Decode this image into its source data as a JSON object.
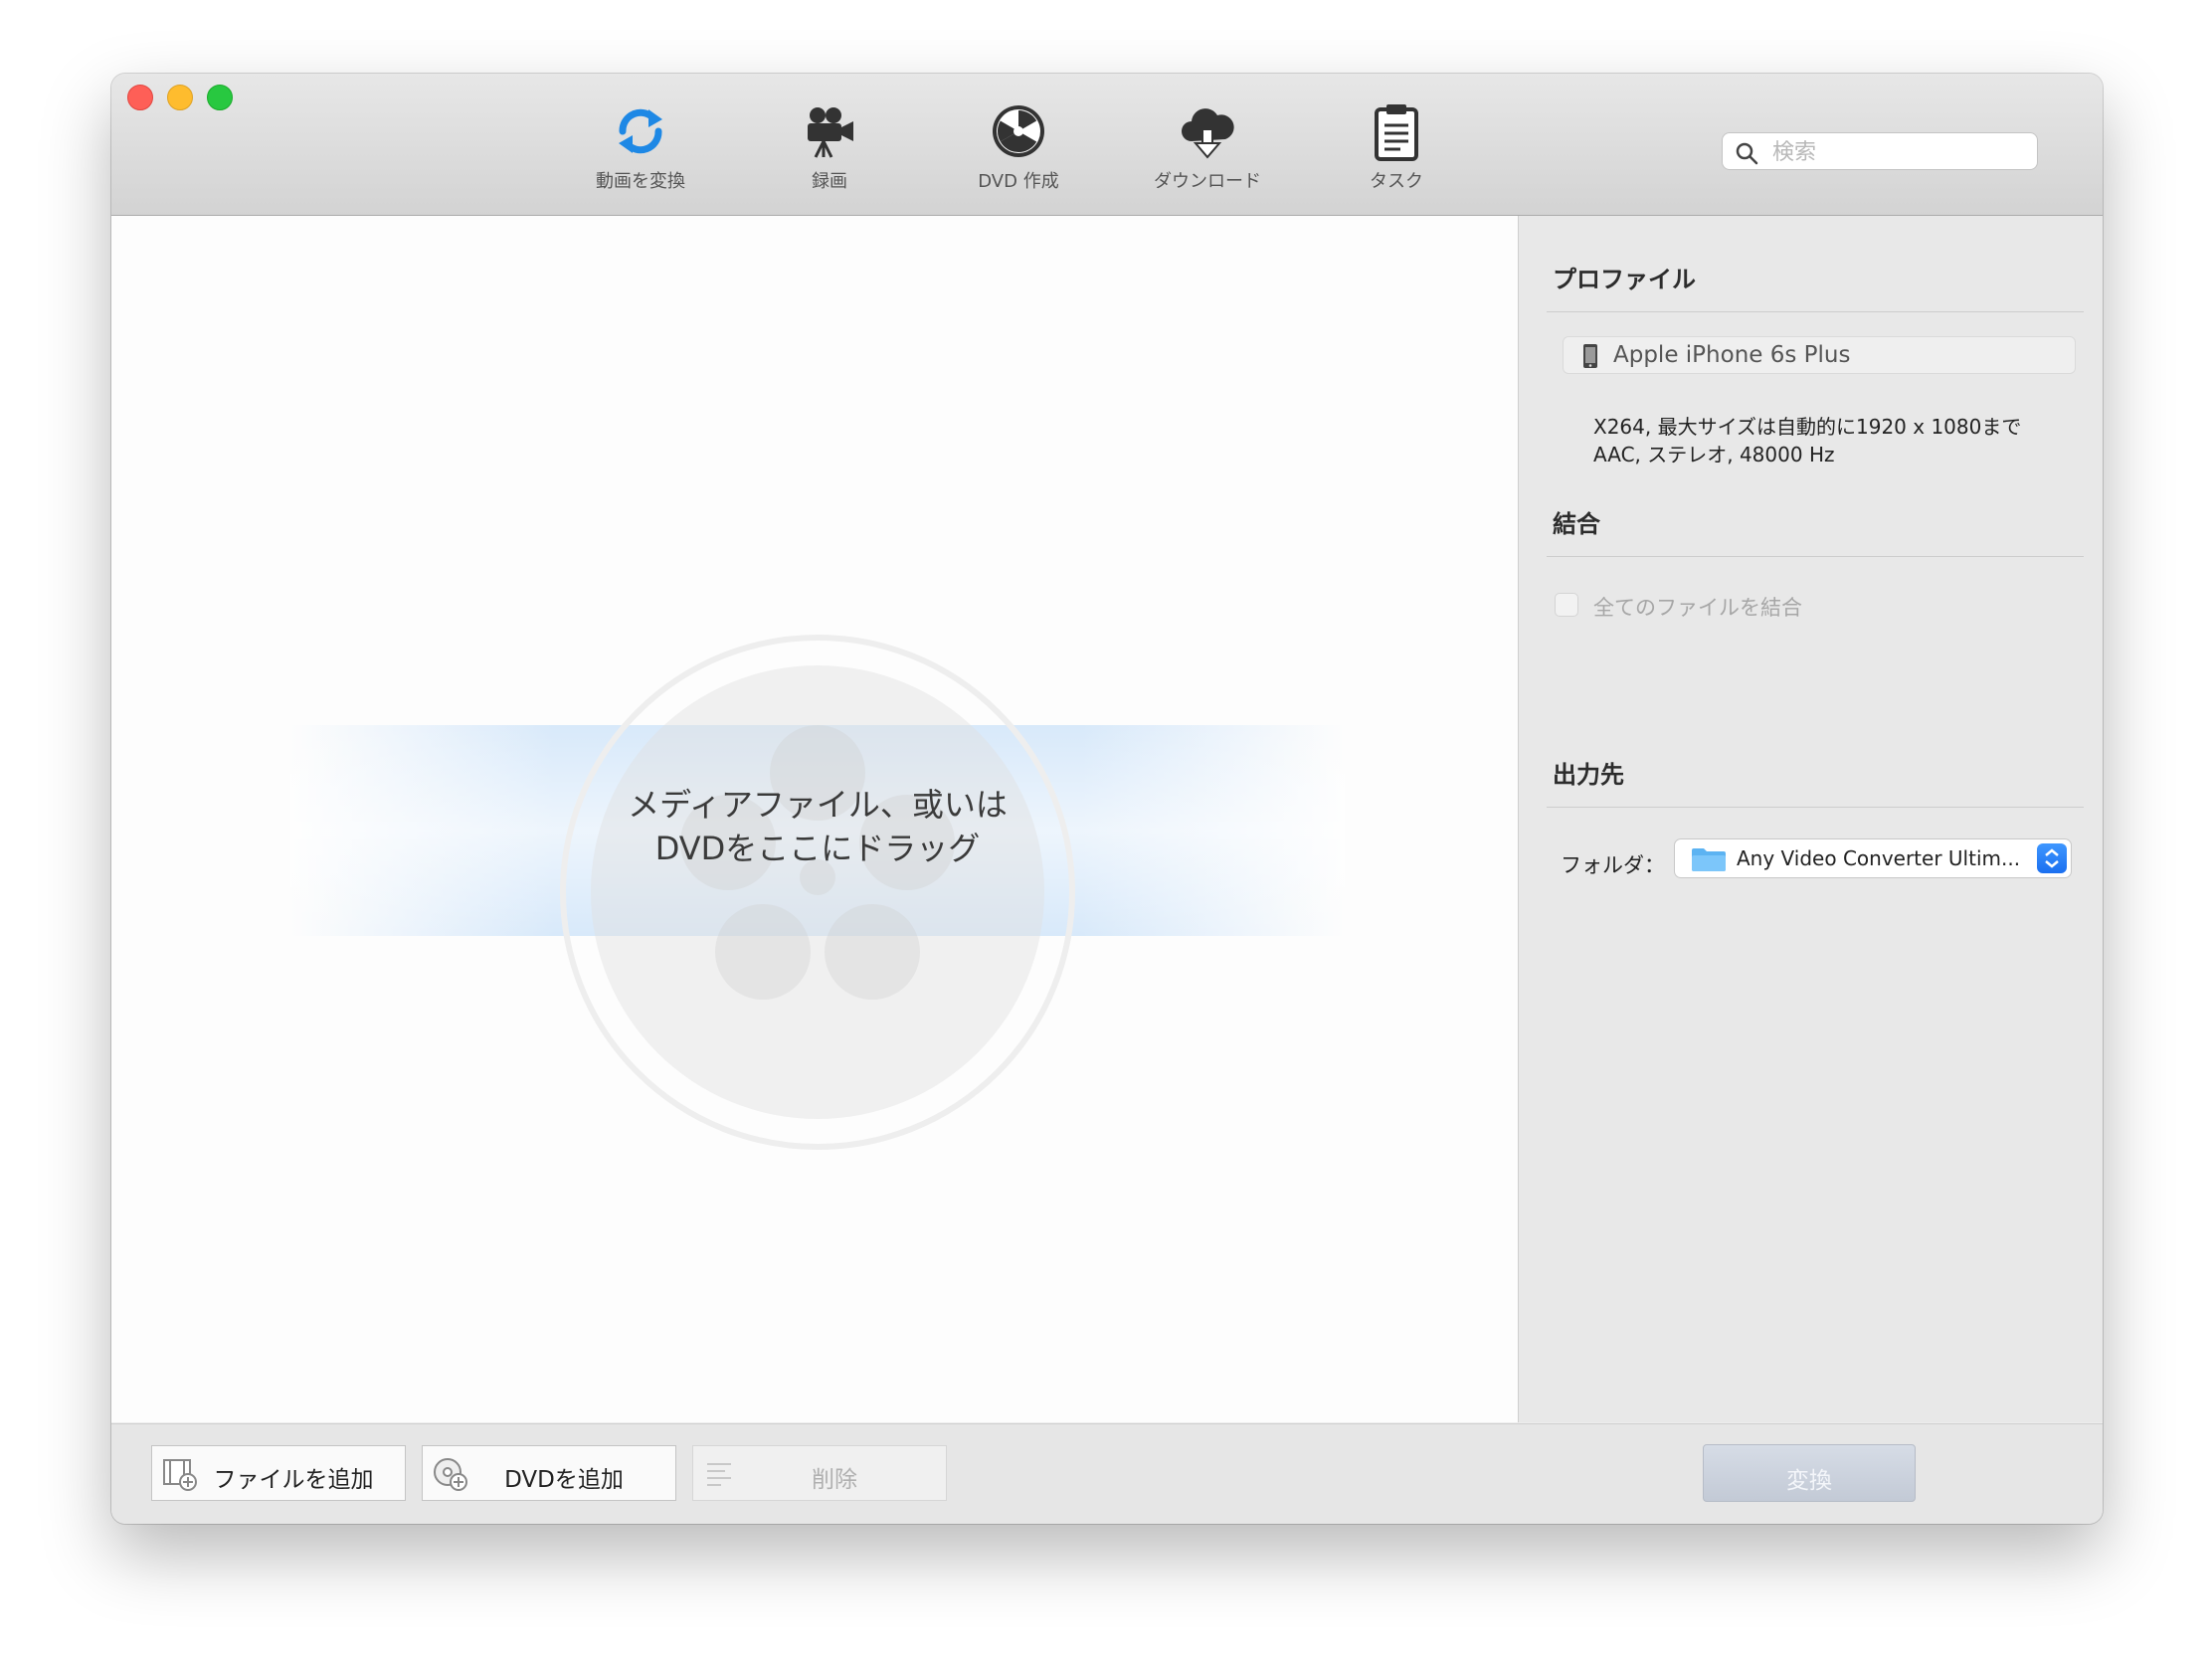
{
  "toolbar": {
    "items": [
      {
        "label": "動画を変換",
        "icon": "convert-refresh-icon",
        "color": "#1e88e5"
      },
      {
        "label": "録画",
        "icon": "video-camera-icon"
      },
      {
        "label": "DVD 作成",
        "icon": "dvd-burn-icon"
      },
      {
        "label": "ダウンロード",
        "icon": "cloud-download-icon"
      },
      {
        "label": "タスク",
        "icon": "clipboard-task-icon"
      }
    ],
    "search_placeholder": "検索"
  },
  "dropzone": {
    "line1": "メディアファイル、或いは",
    "line2": "DVDをここにドラッグ"
  },
  "sidebar": {
    "profile_title": "プロファイル",
    "profile_name": "Apple iPhone 6s Plus",
    "profile_video": "X264, 最大サイズは自動的に1920 x 1080まで",
    "profile_audio": "AAC, ステレオ, 48000 Hz",
    "merge_title": "結合",
    "merge_checkbox_label": "全てのファイルを結合",
    "merge_checked": false,
    "output_title": "出力先",
    "folder_label": "フォルダ：",
    "folder_value": "Any Video Converter Ultim..."
  },
  "bottom": {
    "add_file": "ファイルを追加",
    "add_dvd": "DVDを追加",
    "delete": "削除",
    "convert": "変換"
  }
}
